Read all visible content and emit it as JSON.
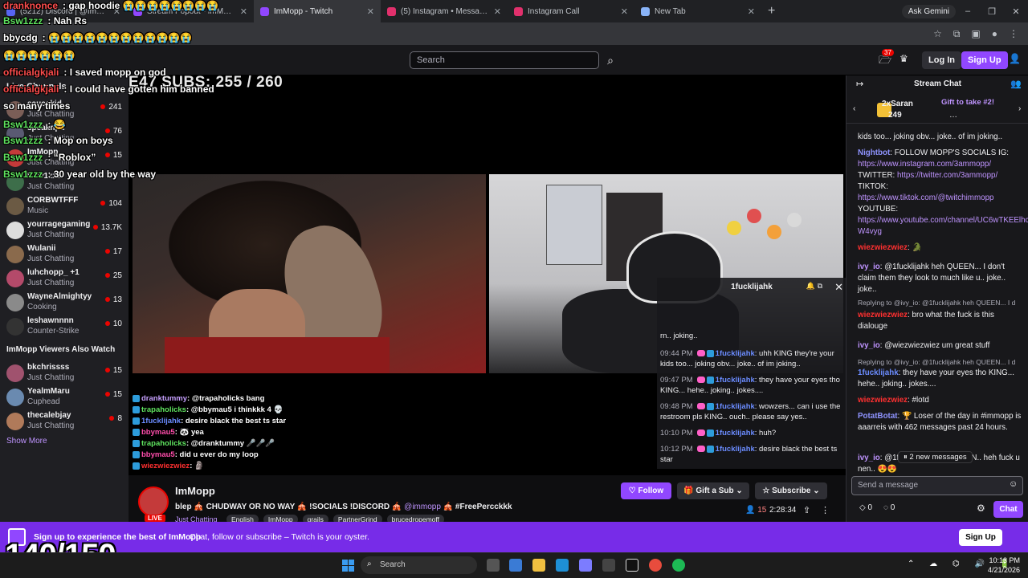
{
  "browser": {
    "tabs": [
      {
        "label": "(5212) Discord | @ImMopp",
        "color": "#5865f2"
      },
      {
        "label": "Stream Popout - ImMopp",
        "color": "#9147ff"
      },
      {
        "label": "ImMopp - Twitch",
        "color": "#9147ff",
        "active": true
      },
      {
        "label": "(5) Instagram • Messages",
        "color": "#e1306c"
      },
      {
        "label": "Instagram Call",
        "color": "#e1306c"
      },
      {
        "label": "New Tab",
        "color": "#8ab4f8"
      }
    ],
    "gemini": "Ask Gemini"
  },
  "nav": {
    "search_placeholder": "Search",
    "notif_count": "37",
    "login": "Log In",
    "signup": "Sign Up"
  },
  "overlay_chat": [
    {
      "user": "dranknonce",
      "text": "gap hoodie 😭😭😭😭😭😭😭😭",
      "color": "#ff4d4d"
    },
    {
      "user": "Bsw1zzz",
      "text": "Nah Rs",
      "color": "#5fe35f"
    },
    {
      "user": "bbycdg",
      "text": "😭😭😭😭😭😭😭😭😭😭😭😭",
      "color": "#ffffff"
    },
    {
      "user": "",
      "text": "😭😭😭😭😭😭",
      "color": "#ffffff"
    },
    {
      "user": "officialgkjali",
      "text": "I saved mopp on god",
      "color": "#ff4d4d"
    },
    {
      "user": "officialgkjali",
      "text": "I could have gotten him banned",
      "color": "#ff4d4d"
    },
    {
      "user": "",
      "text": "so many times",
      "color": "#ffffff"
    },
    {
      "user": "Bsw1zzz",
      "text": "😂",
      "color": "#5fe35f"
    },
    {
      "user": "Bsw1zzz",
      "text": "Mop on boys",
      "color": "#5fe35f"
    },
    {
      "user": "Bsw1zzz",
      "text": "“Roblox”",
      "color": "#5fe35f"
    },
    {
      "user": "Bsw1zzz",
      "text": "30 year old by the way",
      "color": "#5fe35f"
    }
  ],
  "subs_goal": "E47 SUBS: 255 / 260",
  "sidebar": {
    "header": "Live Channels",
    "channels": [
      {
        "name": "saucekid",
        "game": "Just Chatting",
        "viewers": "241",
        "color": "#7b5e57"
      },
      {
        "name": "speaknpd",
        "game": "Just Chatting",
        "viewers": "76",
        "color": "#5a5a72"
      },
      {
        "name": "ImMopp",
        "game": "Just Chatting",
        "viewers": "15",
        "color": "#c43a3a"
      },
      {
        "name": "Bsw1zzz",
        "game": "Just Chatting",
        "viewers": "",
        "color": "#3d6e4a"
      },
      {
        "name": "CORBWTFFF",
        "game": "Music",
        "viewers": "104",
        "color": "#6b5a44"
      },
      {
        "name": "yourragegaming",
        "game": "Just Chatting",
        "viewers": "13.7K",
        "color": "#dddddd"
      },
      {
        "name": "Wulanii",
        "game": "Just Chatting",
        "viewers": "17",
        "color": "#8a6a4c"
      },
      {
        "name": "luhchopp_ +1",
        "game": "Just Chatting",
        "viewers": "25",
        "color": "#b44a6a"
      },
      {
        "name": "WayneAlmightyy",
        "game": "Cooking",
        "viewers": "13",
        "color": "#8a8a8a"
      },
      {
        "name": "leshawnnnn",
        "game": "Counter-Strike",
        "viewers": "10",
        "color": "#333333"
      }
    ],
    "section2": "ImMopp Viewers Also Watch",
    "also": [
      {
        "name": "bkchrissss",
        "game": "Just Chatting",
        "viewers": "15",
        "color": "#a0526e"
      },
      {
        "name": "YealmMaru",
        "game": "Cuphead",
        "viewers": "15",
        "color": "#6a8ab0"
      },
      {
        "name": "thecalebjay",
        "game": "Just Chatting",
        "viewers": "8",
        "color": "#b07a5a"
      }
    ],
    "show_more": "Show More"
  },
  "video_chat": [
    {
      "user": "dranktummy",
      "text": ": @trapaholicks bang",
      "color": "#c7a0ff"
    },
    {
      "user": "trapaholicks",
      "text": ": @bbymau5 i thinkkk 4 💀",
      "color": "#5fe35f"
    },
    {
      "user": "1fucklijahk",
      "text": ": desire black the best ts star",
      "color": "#6b8cff"
    },
    {
      "user": "bbymau5",
      "text": ": 🐼 yea",
      "color": "#ff4dab"
    },
    {
      "user": "trapaholicks",
      "text": ": @dranktummy 🎤🎤🎤",
      "color": "#5fe35f"
    },
    {
      "user": "bbymau5",
      "text": ": did u ever do my loop",
      "color": "#ff4dab"
    },
    {
      "user": "wiezwiezwiez",
      "text": ": 🗿",
      "color": "#ff3030"
    }
  ],
  "popout": {
    "title": "1fucklijahk",
    "lines": [
      {
        "time": "",
        "user": "",
        "text": "rn.. joking.."
      },
      {
        "time": "09:44 PM",
        "user": "1fucklijahk",
        "text": ": uhh KING they're your kids too... joking obv... joke.. of im joking.."
      },
      {
        "time": "09:47 PM",
        "user": "1fucklijahk",
        "text": ": they have your eyes tho KING... hehe.. joking.. jokes...."
      },
      {
        "time": "09:48 PM",
        "user": "1fucklijahk",
        "text": ": wowzers... can i use the restroom pls KING.. ouch.. please say yes.."
      },
      {
        "time": "10:10 PM",
        "user": "1fucklijahk",
        "text": ": huh?"
      },
      {
        "time": "10:12 PM",
        "user": "1fucklijahk",
        "text": ": desire black the best ts star"
      }
    ]
  },
  "stream": {
    "channel": "ImMopp",
    "live": "LIVE",
    "title_pre": "blep 🎪 CHUDWAY OR NO WAY 🎪 !SOCIALS !DISCORD 🎪 ",
    "title_mention": "@immopp",
    "title_post": " 🎪 #FreePercckkk",
    "category": "Just Chatting",
    "tags": [
      "English",
      "ImMopp",
      "grails",
      "PartnerGrind",
      "brucedropemoff"
    ],
    "follow": "Follow",
    "gift": "Gift a Sub",
    "subscribe": "Subscribe",
    "viewers": "15",
    "uptime": "2:28:34"
  },
  "chat": {
    "header": "Stream Chat",
    "gift_user": "2xSaran",
    "gift_count": "249",
    "gift_text": "Gift to take #2!",
    "messages": [
      {
        "user": "",
        "text": "kids too... joking obv... joke.. of im joking..",
        "color": "#efeff1"
      },
      {
        "user": "Nightbot",
        "text": ": FOLLOW MOPP'S SOCIALS IG: ",
        "link": "https://www.instagram.com/3ammopp/",
        "color": "#8f94ff"
      },
      {
        "user": "",
        "text": "TWITTER: ",
        "link": "https://twitter.com/3ammopp/",
        "color": "#efeff1"
      },
      {
        "user": "",
        "text": "TIKTOK:",
        "link": "",
        "color": "#efeff1"
      },
      {
        "user": "",
        "text": "",
        "link": "https://www.tiktok.com/@twitchimmopp",
        "color": "#efeff1"
      },
      {
        "user": "",
        "text": "YOUTUBE:",
        "link": "",
        "color": "#efeff1"
      },
      {
        "user": "",
        "text": "",
        "link": "https://www.youtube.com/channel/UC6wTKEElhcbDmjU9v-W4vyg",
        "color": "#efeff1"
      },
      {
        "user": "wiezwiezwiez",
        "text": ": 🐊",
        "color": "#ff3030"
      },
      {
        "user": "ivy_io",
        "text": ": @1fucklijahk heh QUEEN... I don't claim them they look to much like u.. joke.. joke..",
        "color": "#bf94ff"
      },
      {
        "user": "wiezwiezwiez",
        "text": ": bro what the fuck is this dialouge",
        "color": "#ff3030"
      },
      {
        "user": "ivy_io",
        "text": ": @wiezwiezwiez um great stuff",
        "color": "#bf94ff"
      },
      {
        "user": "1fucklijahk",
        "text": ": they have your eyes tho KING... hehe.. joking.. jokes....",
        "color": "#6b8cff"
      },
      {
        "user": "wiezwiezwiez",
        "text": ": #lotd",
        "color": "#ff3030"
      },
      {
        "user": "PotatBotat",
        "text": ": 🏆 Loser of the day in #immopp is aaarreis with 462 messages past 24 hours.",
        "color": "#8f94ff"
      },
      {
        "user": "ivy_io",
        "text": ": @1fuckli...dn't tho QUEEN.. heh fuck u nen.. 😍😍",
        "color": "#bf94ff"
      }
    ],
    "replies": [
      "Replying to @ivy_io: @1fucklijahk heh QUEEN... I d",
      "Replying to @ivy_io: @1fucklijahk heh QUEEN... I d"
    ],
    "new_messages": "2 new messages",
    "placeholder": "Send a message",
    "bits": "0",
    "points": "0",
    "chat_btn": "Chat"
  },
  "banner": {
    "text1": "Sign up to experience the best of ImMopp",
    "text2": "Chat, follow or subscribe – Twitch is your oyster.",
    "signup": "Sign Up",
    "counter": "140/150"
  },
  "taskbar": {
    "search": "Search",
    "time": "10:13 PM",
    "date": "4/21/2026"
  }
}
